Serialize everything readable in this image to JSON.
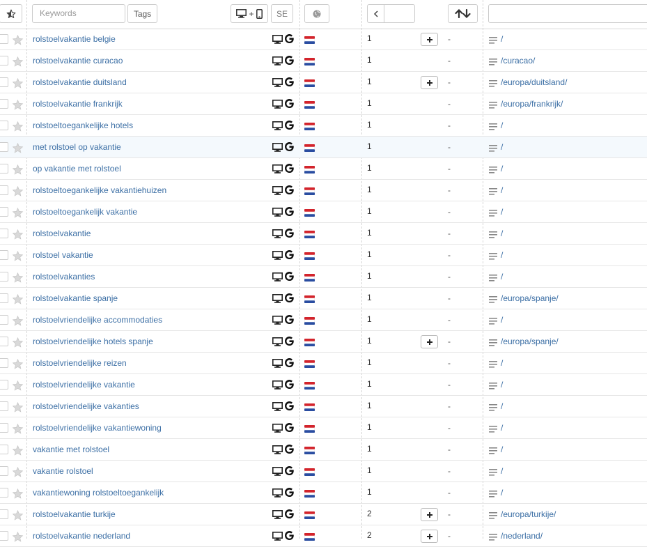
{
  "toolbar": {
    "keywords_placeholder": "Keywords",
    "tags_label": "Tags",
    "device_label": "+",
    "se_label": "SE",
    "search_value": ""
  },
  "rows": [
    {
      "keyword": "rolstoelvakantie belgie",
      "position": "1",
      "has_plus": true,
      "dash": "-",
      "url": "/"
    },
    {
      "keyword": "rolstoelvakantie curacao",
      "position": "1",
      "has_plus": false,
      "dash": "-",
      "url": "/curacao/"
    },
    {
      "keyword": "rolstoelvakantie duitsland",
      "position": "1",
      "has_plus": true,
      "dash": "-",
      "url": "/europa/duitsland/"
    },
    {
      "keyword": "rolstoelvakantie frankrijk",
      "position": "1",
      "has_plus": false,
      "dash": "-",
      "url": "/europa/frankrijk/"
    },
    {
      "keyword": "rolstoeltoegankelijke hotels",
      "position": "1",
      "has_plus": false,
      "dash": "-",
      "url": "/"
    },
    {
      "keyword": "met rolstoel op vakantie",
      "position": "1",
      "has_plus": false,
      "dash": "-",
      "url": "/",
      "highlight": true
    },
    {
      "keyword": "op vakantie met rolstoel",
      "position": "1",
      "has_plus": false,
      "dash": "-",
      "url": "/"
    },
    {
      "keyword": "rolstoeltoegankelijke vakantiehuizen",
      "position": "1",
      "has_plus": false,
      "dash": "-",
      "url": "/"
    },
    {
      "keyword": "rolstoeltoegankelijk vakantie",
      "position": "1",
      "has_plus": false,
      "dash": "-",
      "url": "/"
    },
    {
      "keyword": "rolstoelvakantie",
      "position": "1",
      "has_plus": false,
      "dash": "-",
      "url": "/"
    },
    {
      "keyword": "rolstoel vakantie",
      "position": "1",
      "has_plus": false,
      "dash": "-",
      "url": "/"
    },
    {
      "keyword": "rolstoelvakanties",
      "position": "1",
      "has_plus": false,
      "dash": "-",
      "url": "/"
    },
    {
      "keyword": "rolstoelvakantie spanje",
      "position": "1",
      "has_plus": false,
      "dash": "-",
      "url": "/europa/spanje/"
    },
    {
      "keyword": "rolstoelvriendelijke accommodaties",
      "position": "1",
      "has_plus": false,
      "dash": "-",
      "url": "/"
    },
    {
      "keyword": "rolstoelvriendelijke hotels spanje",
      "position": "1",
      "has_plus": true,
      "dash": "-",
      "url": "/europa/spanje/"
    },
    {
      "keyword": "rolstoelvriendelijke reizen",
      "position": "1",
      "has_plus": false,
      "dash": "-",
      "url": "/"
    },
    {
      "keyword": "rolstoelvriendelijke vakantie",
      "position": "1",
      "has_plus": false,
      "dash": "-",
      "url": "/"
    },
    {
      "keyword": "rolstoelvriendelijke vakanties",
      "position": "1",
      "has_plus": false,
      "dash": "-",
      "url": "/"
    },
    {
      "keyword": "rolstoelvriendelijke vakantiewoning",
      "position": "1",
      "has_plus": false,
      "dash": "-",
      "url": "/"
    },
    {
      "keyword": "vakantie met rolstoel",
      "position": "1",
      "has_plus": false,
      "dash": "-",
      "url": "/"
    },
    {
      "keyword": "vakantie rolstoel",
      "position": "1",
      "has_plus": false,
      "dash": "-",
      "url": "/"
    },
    {
      "keyword": "vakantiewoning rolstoeltoegankelijk",
      "position": "1",
      "has_plus": false,
      "dash": "-",
      "url": "/"
    },
    {
      "keyword": "rolstoelvakantie turkije",
      "position": "2",
      "has_plus": true,
      "dash": "-",
      "url": "/europa/turkije/"
    },
    {
      "keyword": "rolstoelvakantie nederland",
      "position": "2",
      "has_plus": true,
      "dash": "-",
      "url": "/nederland/"
    }
  ],
  "icons": {
    "star_favorite": "star-icon",
    "desktop": "desktop-icon",
    "mobile": "mobile-icon",
    "google": "google-icon",
    "globe": "globe-icon",
    "flag": "netherlands-flag-icon",
    "chevron_left": "chevron-left-icon",
    "sort": "sort-arrows-icon",
    "lines": "lines-icon",
    "plus": "plus-icon"
  },
  "colors": {
    "link": "#3c6fa5",
    "flag_red": "#d3242c",
    "flag_white": "#ffffff",
    "flag_blue": "#2a4da1",
    "row_highlight": "#f4f9fd"
  }
}
